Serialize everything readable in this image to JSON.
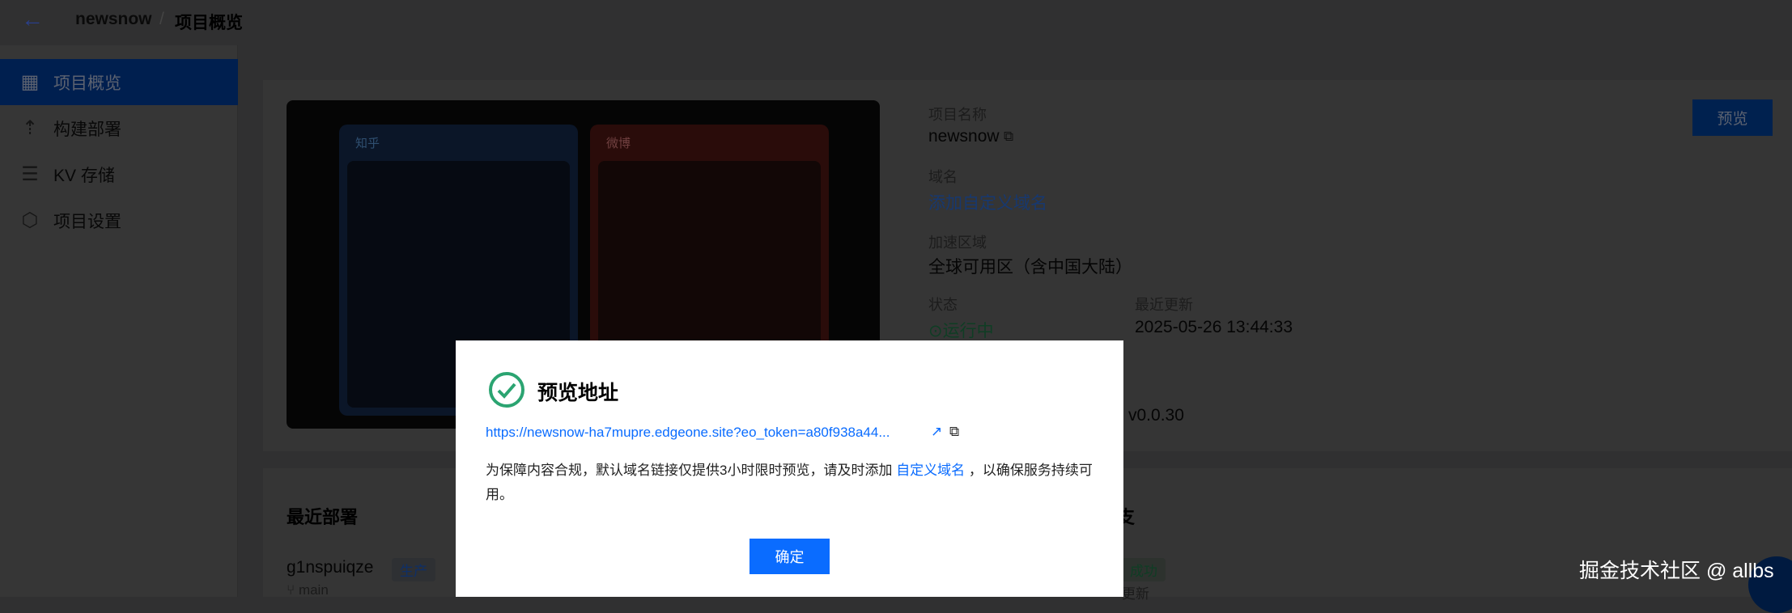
{
  "header": {
    "back_icon": "arrow-left-icon",
    "project": "newsnow",
    "separator": "/",
    "page": "项目概览"
  },
  "sidebar": {
    "items": [
      {
        "label": "项目概览",
        "icon": "dashboard-icon",
        "active": true
      },
      {
        "label": "构建部署",
        "icon": "upload-icon"
      },
      {
        "label": "KV 存储",
        "icon": "database-icon"
      },
      {
        "label": "项目设置",
        "icon": "settings-icon"
      }
    ]
  },
  "overview": {
    "name_label": "项目名称",
    "name": "newsnow",
    "domain_label": "域名",
    "domain_link": "添加自定义域名",
    "region_label": "加速区域",
    "region": "全球可用区（含中国大陆）",
    "status_label": "状态",
    "status": "运行中",
    "updated_label": "最近更新",
    "updated": "2025-05-26 13:44:33",
    "version": "v0.0.30",
    "preview_button": "预览",
    "thumb_labels": [
      "知乎",
      "微博"
    ]
  },
  "deploy": {
    "title": "最近部署",
    "id": "g1nspuiqze",
    "env_badge": "生产",
    "branch": "main",
    "right_title": "支",
    "status": "成功",
    "status_sub": "更新"
  },
  "modal": {
    "title": "预览地址",
    "url": "https://newsnow-ha7mupre.edgeone.site?eo_token=a80f938a44...",
    "text_before": "为保障内容合规，默认域名链接仅提供3小时限时预览，请及时添加 ",
    "text_link": "自定义域名",
    "text_after": " ，以确保服务持续可用。",
    "confirm": "确定"
  },
  "watermark": "掘金技术社区 @ allbs",
  "colors": {
    "primary": "#0052d9",
    "button": "#0a6cff",
    "success": "#2ba471"
  }
}
